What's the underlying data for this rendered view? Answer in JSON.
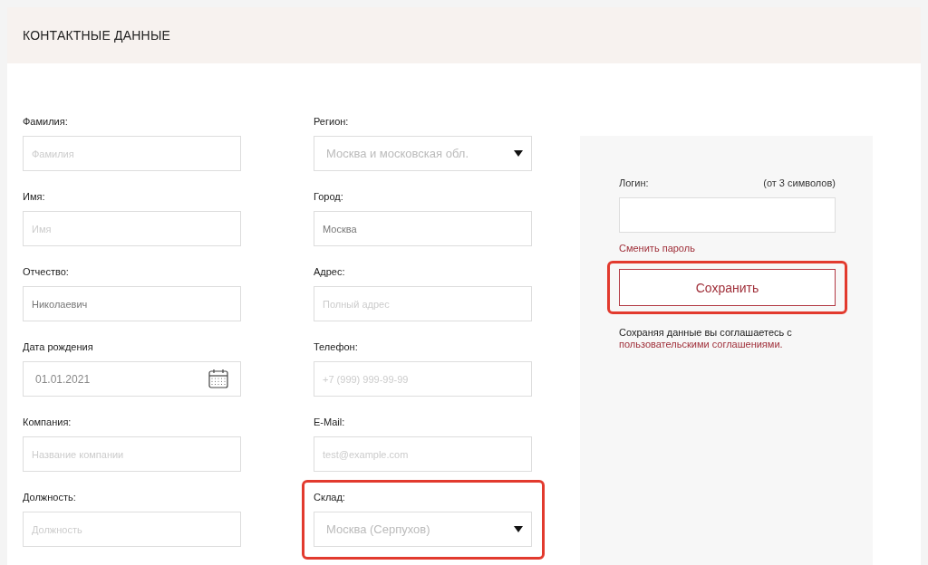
{
  "header": {
    "title": "КОНТАКТНЫЕ ДАННЫЕ"
  },
  "columns": [
    {
      "fields": [
        {
          "label": "Фамилия:",
          "kind": "text",
          "placeholder": "Фамилия",
          "highlighted": false
        },
        {
          "label": "Имя:",
          "kind": "text",
          "placeholder": "Имя",
          "highlighted": false
        },
        {
          "label": "Отчество:",
          "kind": "text",
          "value": "Николаевич",
          "highlighted": false
        },
        {
          "label": "Дата рождения",
          "kind": "date",
          "value": "01.01.2021",
          "highlighted": false
        },
        {
          "label": "Компания:",
          "kind": "text",
          "placeholder": "Название компании",
          "highlighted": false
        },
        {
          "label": "Должность:",
          "kind": "text",
          "placeholder": "Должность",
          "highlighted": false
        }
      ]
    },
    {
      "fields": [
        {
          "label": "Регион:",
          "kind": "select",
          "placeholder": "Москва и московская обл.",
          "highlighted": false
        },
        {
          "label": "Город:",
          "kind": "text",
          "value": "Москва",
          "highlighted": false
        },
        {
          "label": "Адрес:",
          "kind": "text",
          "placeholder": "Полный адрес",
          "highlighted": false
        },
        {
          "label": "Телефон:",
          "kind": "text",
          "placeholder": "+7 (999) 999-99-99",
          "highlighted": false
        },
        {
          "label": "E-Mail:",
          "kind": "text",
          "placeholder": "test@example.com",
          "highlighted": false
        },
        {
          "label": "Склад:",
          "kind": "select",
          "placeholder": "Москва (Серпухов)",
          "highlighted": true
        }
      ]
    }
  ],
  "account": {
    "login_label": "Логин:",
    "login_hint": "(от 3 символов)",
    "change_password": "Сменить пароль",
    "save_button": {
      "label": "Сохранить",
      "highlighted": true
    },
    "agreement": "Сохраняя данные вы соглашаетесь с",
    "agreement_link": "пользовательскими соглашениями."
  }
}
